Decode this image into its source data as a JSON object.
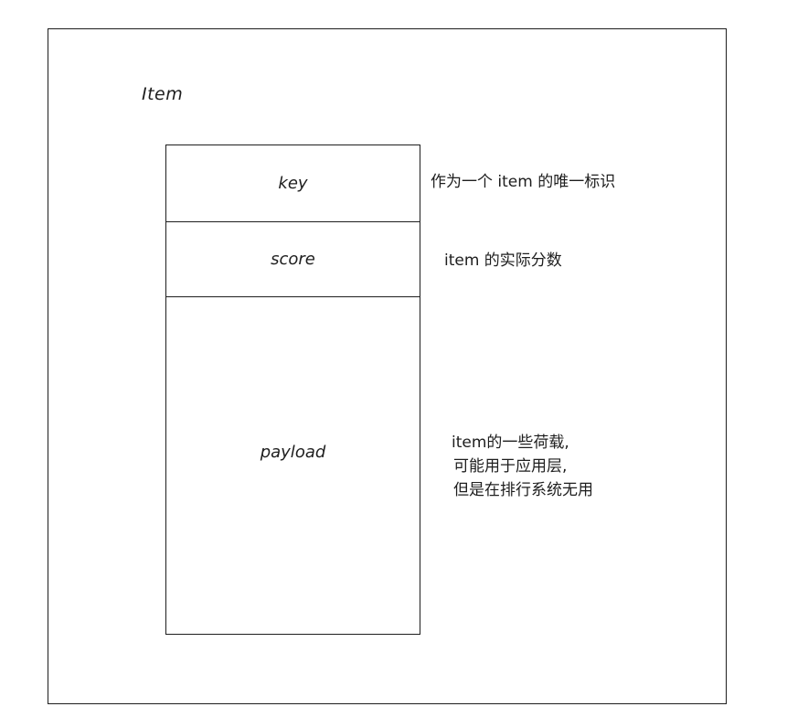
{
  "title": "Item",
  "fields": [
    {
      "label": "key",
      "note": "作为一个 item 的唯一标识"
    },
    {
      "label": "score",
      "note": "item 的实际分数"
    },
    {
      "label": "payload",
      "note_lines": [
        "item的一些荷载,",
        "可能用于应用层,",
        "但是在排行系统无用"
      ]
    }
  ]
}
